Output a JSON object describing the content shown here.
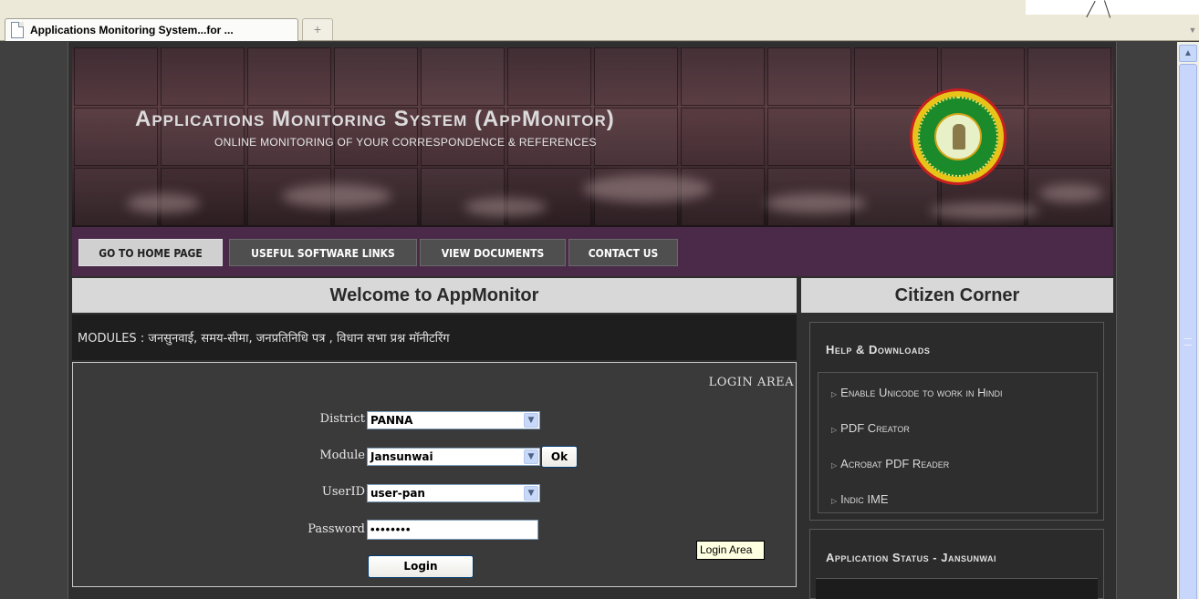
{
  "browser": {
    "tab_title": "Applications Monitoring System...for ...",
    "new_tab_symbol": "+"
  },
  "banner": {
    "title": "Applications Monitoring System (AppMonitor)",
    "subtitle": "ONLINE MONITORING OF YOUR CORRESPONDENCE & REFERENCES"
  },
  "nav": {
    "items": [
      {
        "label": "GO TO HOME PAGE",
        "active": true
      },
      {
        "label": "USEFUL SOFTWARE LINKS",
        "active": false
      },
      {
        "label": "VIEW DOCUMENTS",
        "active": false
      },
      {
        "label": "CONTACT US",
        "active": false
      }
    ]
  },
  "main": {
    "welcome_heading": "Welcome to AppMonitor",
    "modules_text": "MODULES : जनसुनवाई, समय-सीमा, जनप्रतिनिधि पत्र , विधान सभा प्रश्न मॉनीटरिंग"
  },
  "login": {
    "area_label": "LOGIN AREA",
    "district_label": "District",
    "district_value": "PANNA",
    "module_label": "Module",
    "module_value": "Jansunwai",
    "ok_label": "Ok",
    "userid_label": "UserID",
    "userid_value": "user-pan",
    "password_label": "Password",
    "password_value": "••••••••",
    "login_button": "Login",
    "tooltip": "Login Area"
  },
  "citizen": {
    "heading": "Citizen Corner",
    "help_title": "Help & Downloads",
    "help_items": [
      "Enable Unicode to work in Hindi",
      "PDF Creator",
      "Acrobat PDF Reader",
      "Indic IME"
    ],
    "status_title": "Application Status - Jansunwai"
  },
  "colors": {
    "nav_background": "#4a2a48",
    "page_background": "#2f2f2f",
    "header_bar": "#d8d8d8"
  }
}
